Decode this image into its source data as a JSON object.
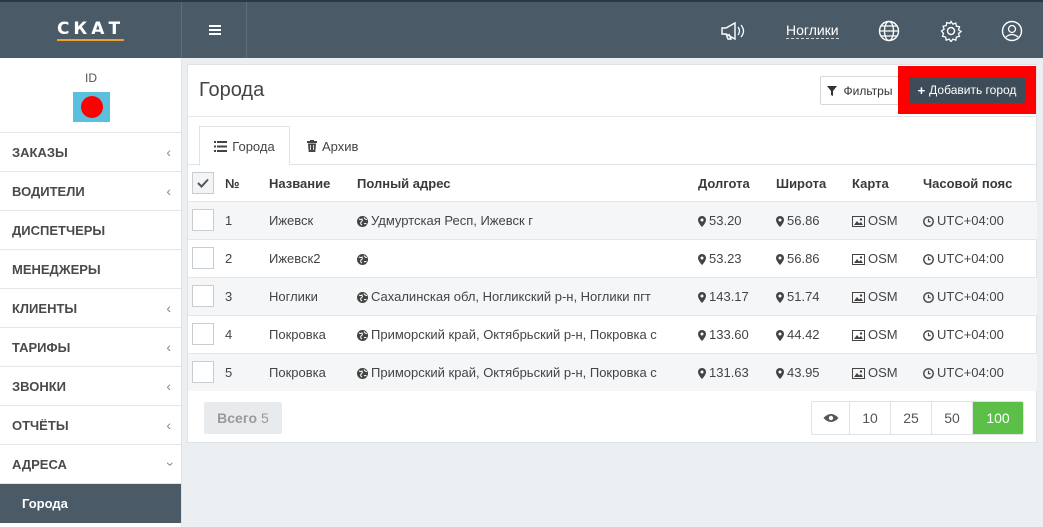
{
  "header": {
    "logo": "СКАТ",
    "city": "Ноглики"
  },
  "sidebar": {
    "profile_id": "ID",
    "items": [
      {
        "label": "ЗАКАЗЫ"
      },
      {
        "label": "ВОДИТЕЛИ"
      },
      {
        "label": "ДИСПЕТЧЕРЫ"
      },
      {
        "label": "МЕНЕДЖЕРЫ"
      },
      {
        "label": "КЛИЕНТЫ"
      },
      {
        "label": "ТАРИФЫ"
      },
      {
        "label": "ЗВОНКИ"
      },
      {
        "label": "ОТЧЁТЫ"
      },
      {
        "label": "АДРЕСА"
      }
    ],
    "sub_item": "Города"
  },
  "page": {
    "title": "Города",
    "filters_label": "Фильтры",
    "add_label": "Добавить город",
    "highlight_color": "#ff0000"
  },
  "tabs": [
    {
      "label": "Города"
    },
    {
      "label": "Архив"
    }
  ],
  "table": {
    "headers": [
      "№",
      "Название",
      "Полный адрес",
      "Долгота",
      "Широта",
      "Карта",
      "Часовой пояс"
    ],
    "rows": [
      {
        "num": "1",
        "name": "Ижевск",
        "address": "Удмуртская Респ, Ижевск г",
        "lon": "53.20",
        "lat": "56.86",
        "map": "OSM",
        "tz": "UTC+04:00"
      },
      {
        "num": "2",
        "name": "Ижевск2",
        "address": "",
        "lon": "53.23",
        "lat": "56.86",
        "map": "OSM",
        "tz": "UTC+04:00"
      },
      {
        "num": "3",
        "name": "Ноглики",
        "address": "Сахалинская обл, Ногликский р-н, Ноглики пгт",
        "lon": "143.17",
        "lat": "51.74",
        "map": "OSM",
        "tz": "UTC+04:00"
      },
      {
        "num": "4",
        "name": "Покровка",
        "address": "Приморский край, Октябрьский р-н, Покровка с",
        "lon": "133.60",
        "lat": "44.42",
        "map": "OSM",
        "tz": "UTC+04:00"
      },
      {
        "num": "5",
        "name": "Покровка",
        "address": "Приморский край, Октябрьский р-н, Покровка с",
        "lon": "131.63",
        "lat": "43.95",
        "map": "OSM",
        "tz": "UTC+04:00"
      }
    ]
  },
  "footer": {
    "total_label": "Всего",
    "total_value": "5",
    "page_sizes": [
      "10",
      "25",
      "50",
      "100"
    ],
    "active_page_size": "100",
    "active_color": "#5cc048"
  }
}
